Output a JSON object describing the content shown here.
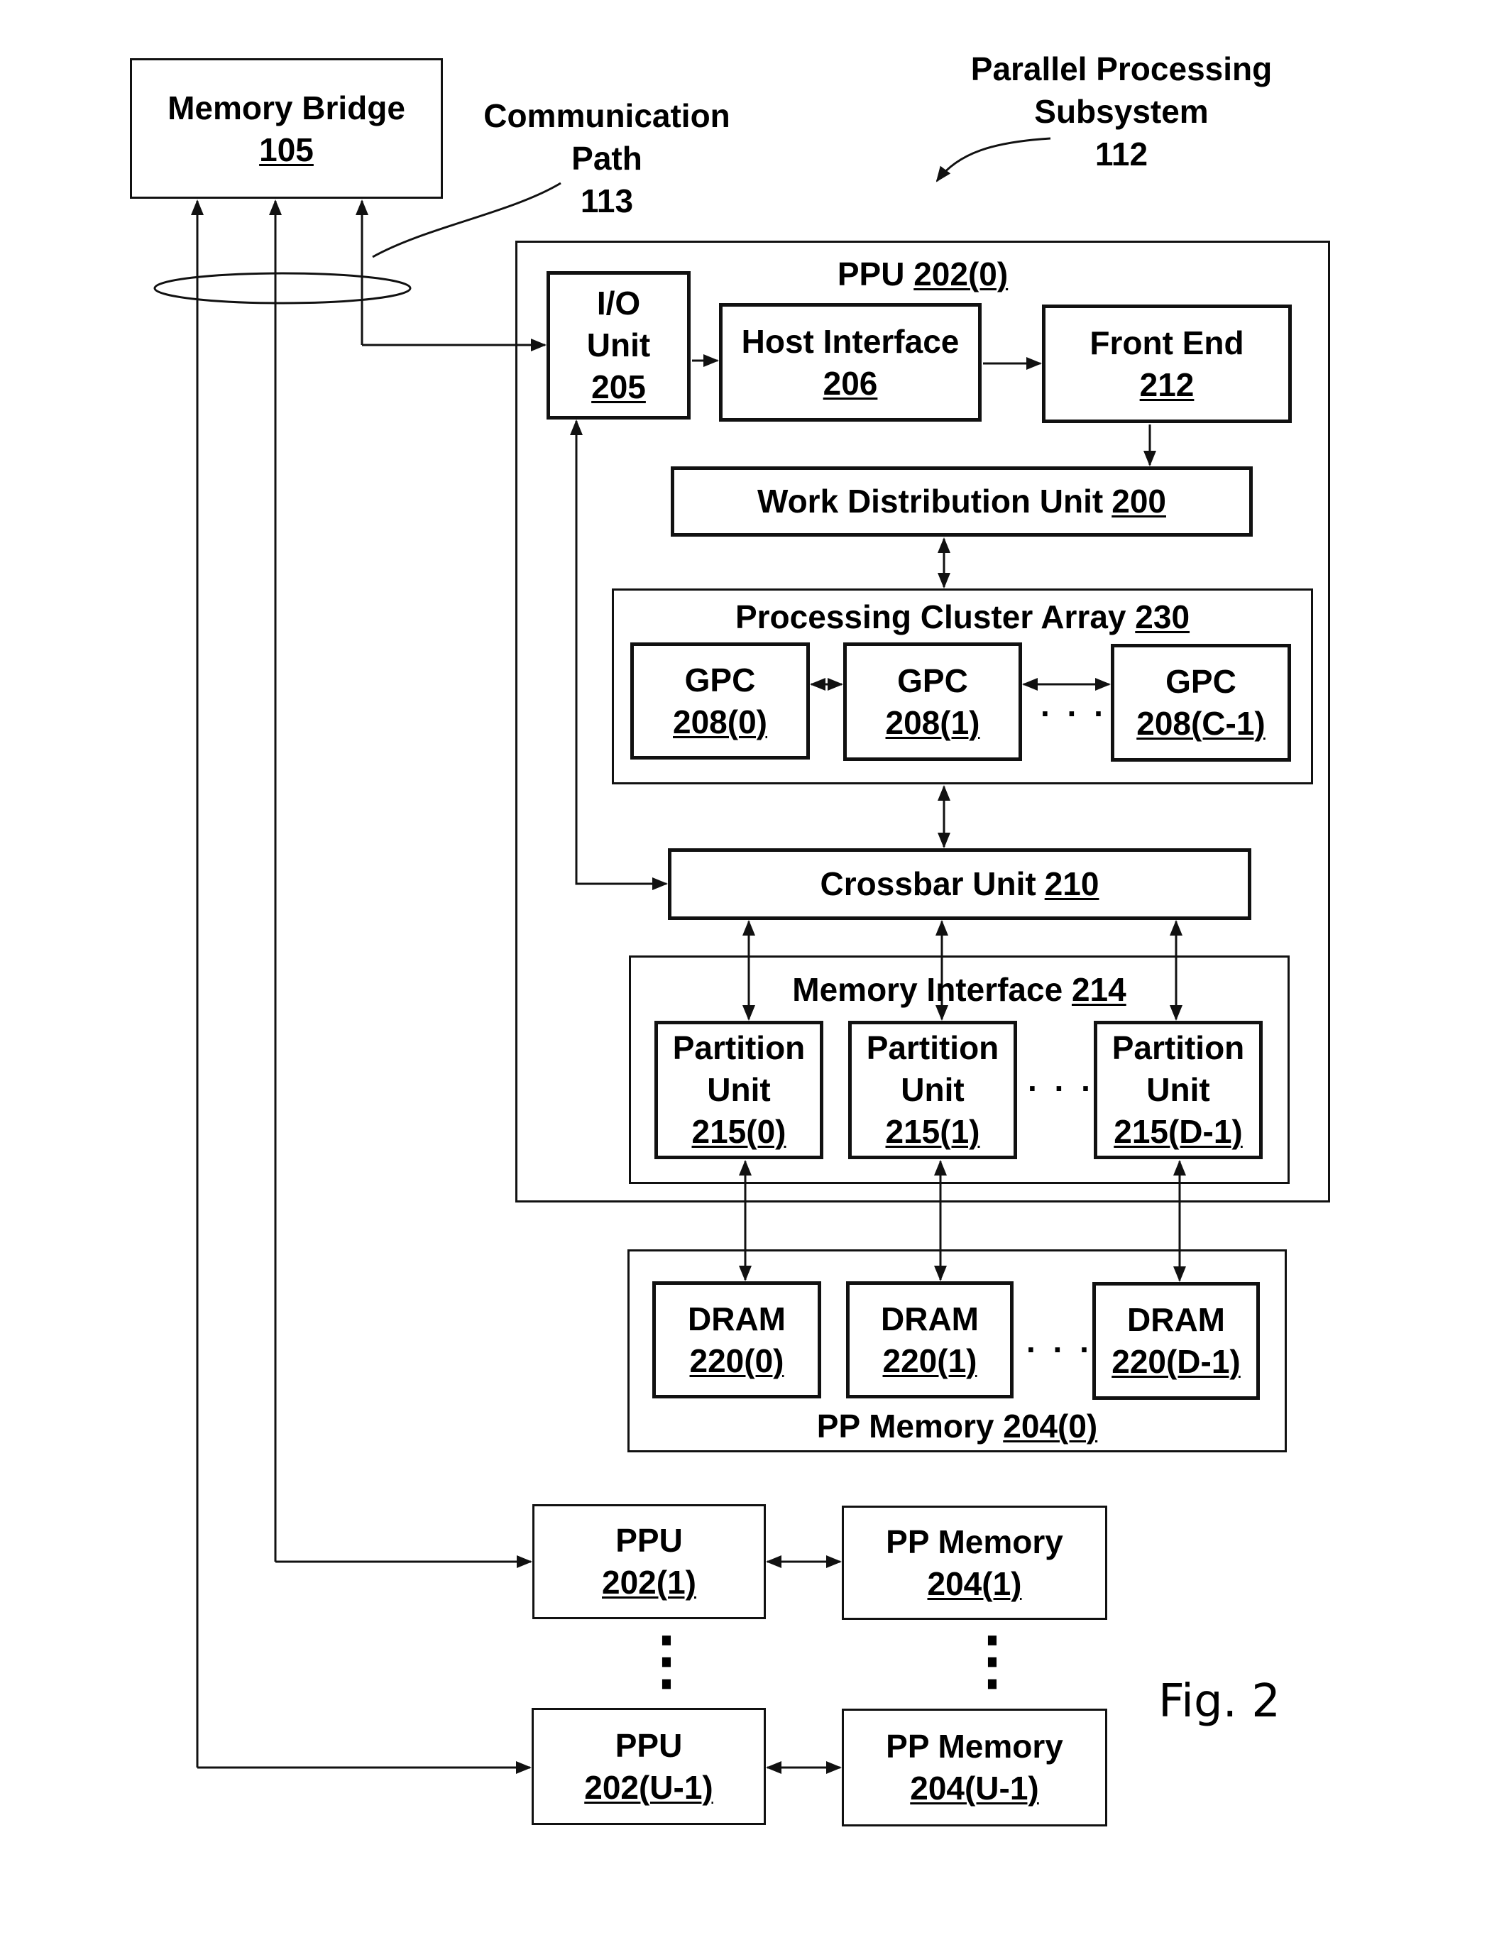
{
  "figure_label": "Fig. 2",
  "annotations": {
    "subsystem": {
      "line1": "Parallel Processing",
      "line2": "Subsystem",
      "ref": "112"
    },
    "comm_path": {
      "line1": "Communication",
      "line2": "Path",
      "ref": "113"
    }
  },
  "memory_bridge": {
    "name": "Memory Bridge",
    "ref": "105"
  },
  "ppu0": {
    "title": "PPU",
    "ref": "202(0)",
    "io_unit": {
      "line1": "I/O",
      "line2": "Unit",
      "ref": "205"
    },
    "host_interface": {
      "name": "Host Interface",
      "ref": "206"
    },
    "front_end": {
      "name": "Front End",
      "ref": "212"
    },
    "work_distribution": {
      "name": "Work Distribution Unit",
      "ref": "200"
    },
    "cluster_array": {
      "name": "Processing Cluster Array",
      "ref": "230",
      "gpcs": [
        {
          "name": "GPC",
          "ref": "208(0)"
        },
        {
          "name": "GPC",
          "ref": "208(1)"
        },
        {
          "name": "GPC",
          "ref": "208(C-1)"
        }
      ],
      "ellipsis": ". . ."
    },
    "crossbar": {
      "name": "Crossbar Unit",
      "ref": "210"
    },
    "memory_interface": {
      "name": "Memory Interface",
      "ref": "214",
      "partitions": [
        {
          "line1": "Partition",
          "line2": "Unit",
          "ref": "215(0)"
        },
        {
          "line1": "Partition",
          "line2": "Unit",
          "ref": "215(1)"
        },
        {
          "line1": "Partition",
          "line2": "Unit",
          "ref": "215(D-1)"
        }
      ],
      "ellipsis": ". . ."
    }
  },
  "pp_memory0": {
    "name": "PP Memory",
    "ref": "204(0)",
    "drams": [
      {
        "name": "DRAM",
        "ref": "220(0)"
      },
      {
        "name": "DRAM",
        "ref": "220(1)"
      },
      {
        "name": "DRAM",
        "ref": "220(D-1)"
      }
    ],
    "ellipsis": ". . ."
  },
  "other_units": [
    {
      "ppu": {
        "name": "PPU",
        "ref": "202(1)"
      },
      "memory": {
        "name": "PP Memory",
        "ref": "204(1)"
      }
    },
    {
      "ppu": {
        "name": "PPU",
        "ref": "202(U-1)"
      },
      "memory": {
        "name": "PP Memory",
        "ref": "204(U-1)"
      }
    }
  ],
  "vertical_ellipsis": "⋮"
}
